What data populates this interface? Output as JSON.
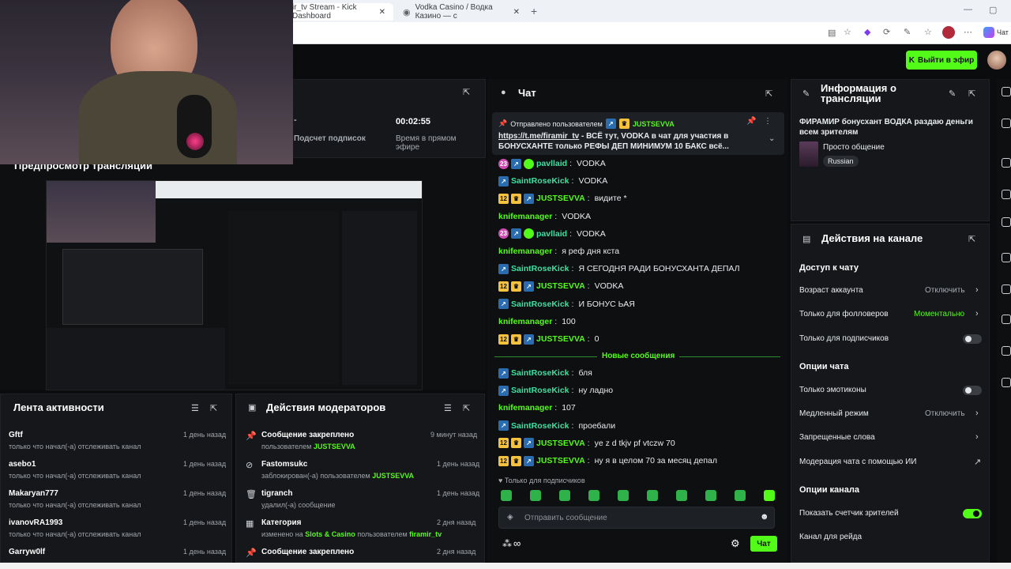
{
  "browser": {
    "tabs": [
      {
        "label": "ir_tv Stream - Kick Dashboard"
      },
      {
        "label": "Vodka Casino / Водка Казино — с"
      }
    ]
  },
  "header": {
    "go_live_label": "Выйти в эфир"
  },
  "stats": {
    "subs_label": "Подсчет подписок",
    "time_value": "00:02:55",
    "time_label": "Время в прямом эфире"
  },
  "preview": {
    "title": "Предпросмотр трансляции"
  },
  "activity": {
    "title": "Лента активности",
    "items": [
      {
        "name": "Gftf",
        "sub": "только что начал(-а) отслеживать канал",
        "time": "1 день назад"
      },
      {
        "name": "asebo1",
        "sub": "только что начал(-а) отслеживать канал",
        "time": "1 день назад"
      },
      {
        "name": "Makaryan777",
        "sub": "только что начал(-а) отслеживать канал",
        "time": "1 день назад"
      },
      {
        "name": "ivanovRA1993",
        "sub": "только что начал(-а) отслеживать канал",
        "time": "1 день назад"
      },
      {
        "name": "Garryw0lf",
        "sub": "",
        "time": "1 день назад"
      }
    ]
  },
  "mod": {
    "title": "Действия модераторов",
    "items": [
      {
        "name": "Сообщение закреплено",
        "sub": "пользователем",
        "hl": "JUSTSEVVA",
        "time": "9 минут назад"
      },
      {
        "name": "Fastomsukc",
        "sub": "заблокирован(-а) пользователем",
        "hl": "JUSTSEVVA",
        "time": "1 день назад"
      },
      {
        "name": "tigranch",
        "sub": "удалил(-а) сообщение",
        "hl": "",
        "time": "1 день назад"
      },
      {
        "name": "Категория",
        "sub": "изменено на",
        "hl": "Slots & Casino",
        "sub2": "пользователем",
        "hl2": "firamir_tv",
        "time": "2 дня назад"
      },
      {
        "name": "Сообщение закреплено",
        "sub": "",
        "hl": "",
        "time": "2 дня назад"
      }
    ]
  },
  "chat": {
    "title": "Чат",
    "pinned_by": "Отправлено пользователем",
    "pinned_user": "JUSTSEVVA",
    "pinned_link": "https://t.me/firamir_tv",
    "pinned_text": " - ВСЁ тут, VODKA в чат для участия в БОНУСХАНТЕ только РЕФЫ ДЕП МИНИМУМ 10 БАКС всё...",
    "messages": [
      {
        "user": "pavllaid",
        "text": "VODKA",
        "badges": [
          "pink",
          "kick",
          "green"
        ],
        "sub": "23"
      },
      {
        "user": "SaintRoseKick",
        "text": "VODKA",
        "badges": [
          "kick"
        ]
      },
      {
        "user": "JUSTSEVVA",
        "text": "видите *",
        "badges": [
          "sub",
          "crown",
          "kick"
        ],
        "sub": "12"
      },
      {
        "user": "knifemanager",
        "text": "VODKA",
        "badges": []
      },
      {
        "user": "pavllaid",
        "text": "VODKA",
        "badges": [
          "pink",
          "kick",
          "green"
        ],
        "sub": "23"
      },
      {
        "user": "knifemanager",
        "text": "я реф дня кста",
        "badges": []
      },
      {
        "user": "SaintRoseKick",
        "text": "Я СЕГОДНЯ РАДИ БОНУСХАНТА ДЕПАЛ",
        "badges": [
          "kick"
        ]
      },
      {
        "user": "JUSTSEVVA",
        "text": "VODKA",
        "badges": [
          "sub",
          "crown",
          "kick"
        ],
        "sub": "12"
      },
      {
        "user": "SaintRoseKick",
        "text": "И БОНУС ЬАЯ",
        "badges": [
          "kick"
        ]
      },
      {
        "user": "knifemanager",
        "text": "100",
        "badges": []
      },
      {
        "user": "JUSTSEVVA",
        "text": "0",
        "badges": [
          "sub",
          "crown",
          "kick"
        ],
        "sub": "12"
      }
    ],
    "new_messages_label": "Новые сообщения",
    "new_messages": [
      {
        "user": "SaintRoseKick",
        "text": "бля",
        "badges": [
          "kick"
        ]
      },
      {
        "user": "SaintRoseKick",
        "text": "ну ладно",
        "badges": [
          "kick"
        ]
      },
      {
        "user": "knifemanager",
        "text": "107",
        "badges": []
      },
      {
        "user": "SaintRoseKick",
        "text": "проебали",
        "badges": [
          "kick"
        ]
      },
      {
        "user": "JUSTSEVVA",
        "text": "ye z d tkjv pf vtczw 70",
        "badges": [
          "sub",
          "crown",
          "kick"
        ],
        "sub": "12"
      },
      {
        "user": "JUSTSEVVA",
        "text": "ну я в целом 70 за месяц депал",
        "badges": [
          "sub",
          "crown",
          "kick"
        ],
        "sub": "12"
      }
    ],
    "subs_only_label": "Только для подписчиков",
    "input_placeholder": "Отправить сообщение",
    "send_label": "Чат",
    "infinity": "∞"
  },
  "info": {
    "title": "Информация о трансляции",
    "stream_title": "ФИРАМИР бонусхант ВОДКА раздаю деньги всем зрителям",
    "category": "Просто общение",
    "tag": "Russian"
  },
  "actions": {
    "title": "Действия на канале",
    "chat_access": "Доступ к чату",
    "account_age": "Возраст аккаунта",
    "account_age_value": "Отключить",
    "followers_only": "Только для фолловеров",
    "followers_only_value": "Моментально",
    "subs_only": "Только для подписчиков",
    "chat_options": "Опции чата",
    "emotes_only": "Только эмотиконы",
    "slow_mode": "Медленный режим",
    "slow_mode_value": "Отключить",
    "banned_words": "Запрещенные слова",
    "ai_moderation": "Модерация чата с помощью ИИ",
    "channel_options": "Опции канала",
    "show_viewers": "Показать счетчик зрителей",
    "raid_channel": "Канал для рейда"
  },
  "colors": {
    "accent": "#53fc18",
    "bg": "#0b0c0d",
    "panel": "#15171a"
  }
}
